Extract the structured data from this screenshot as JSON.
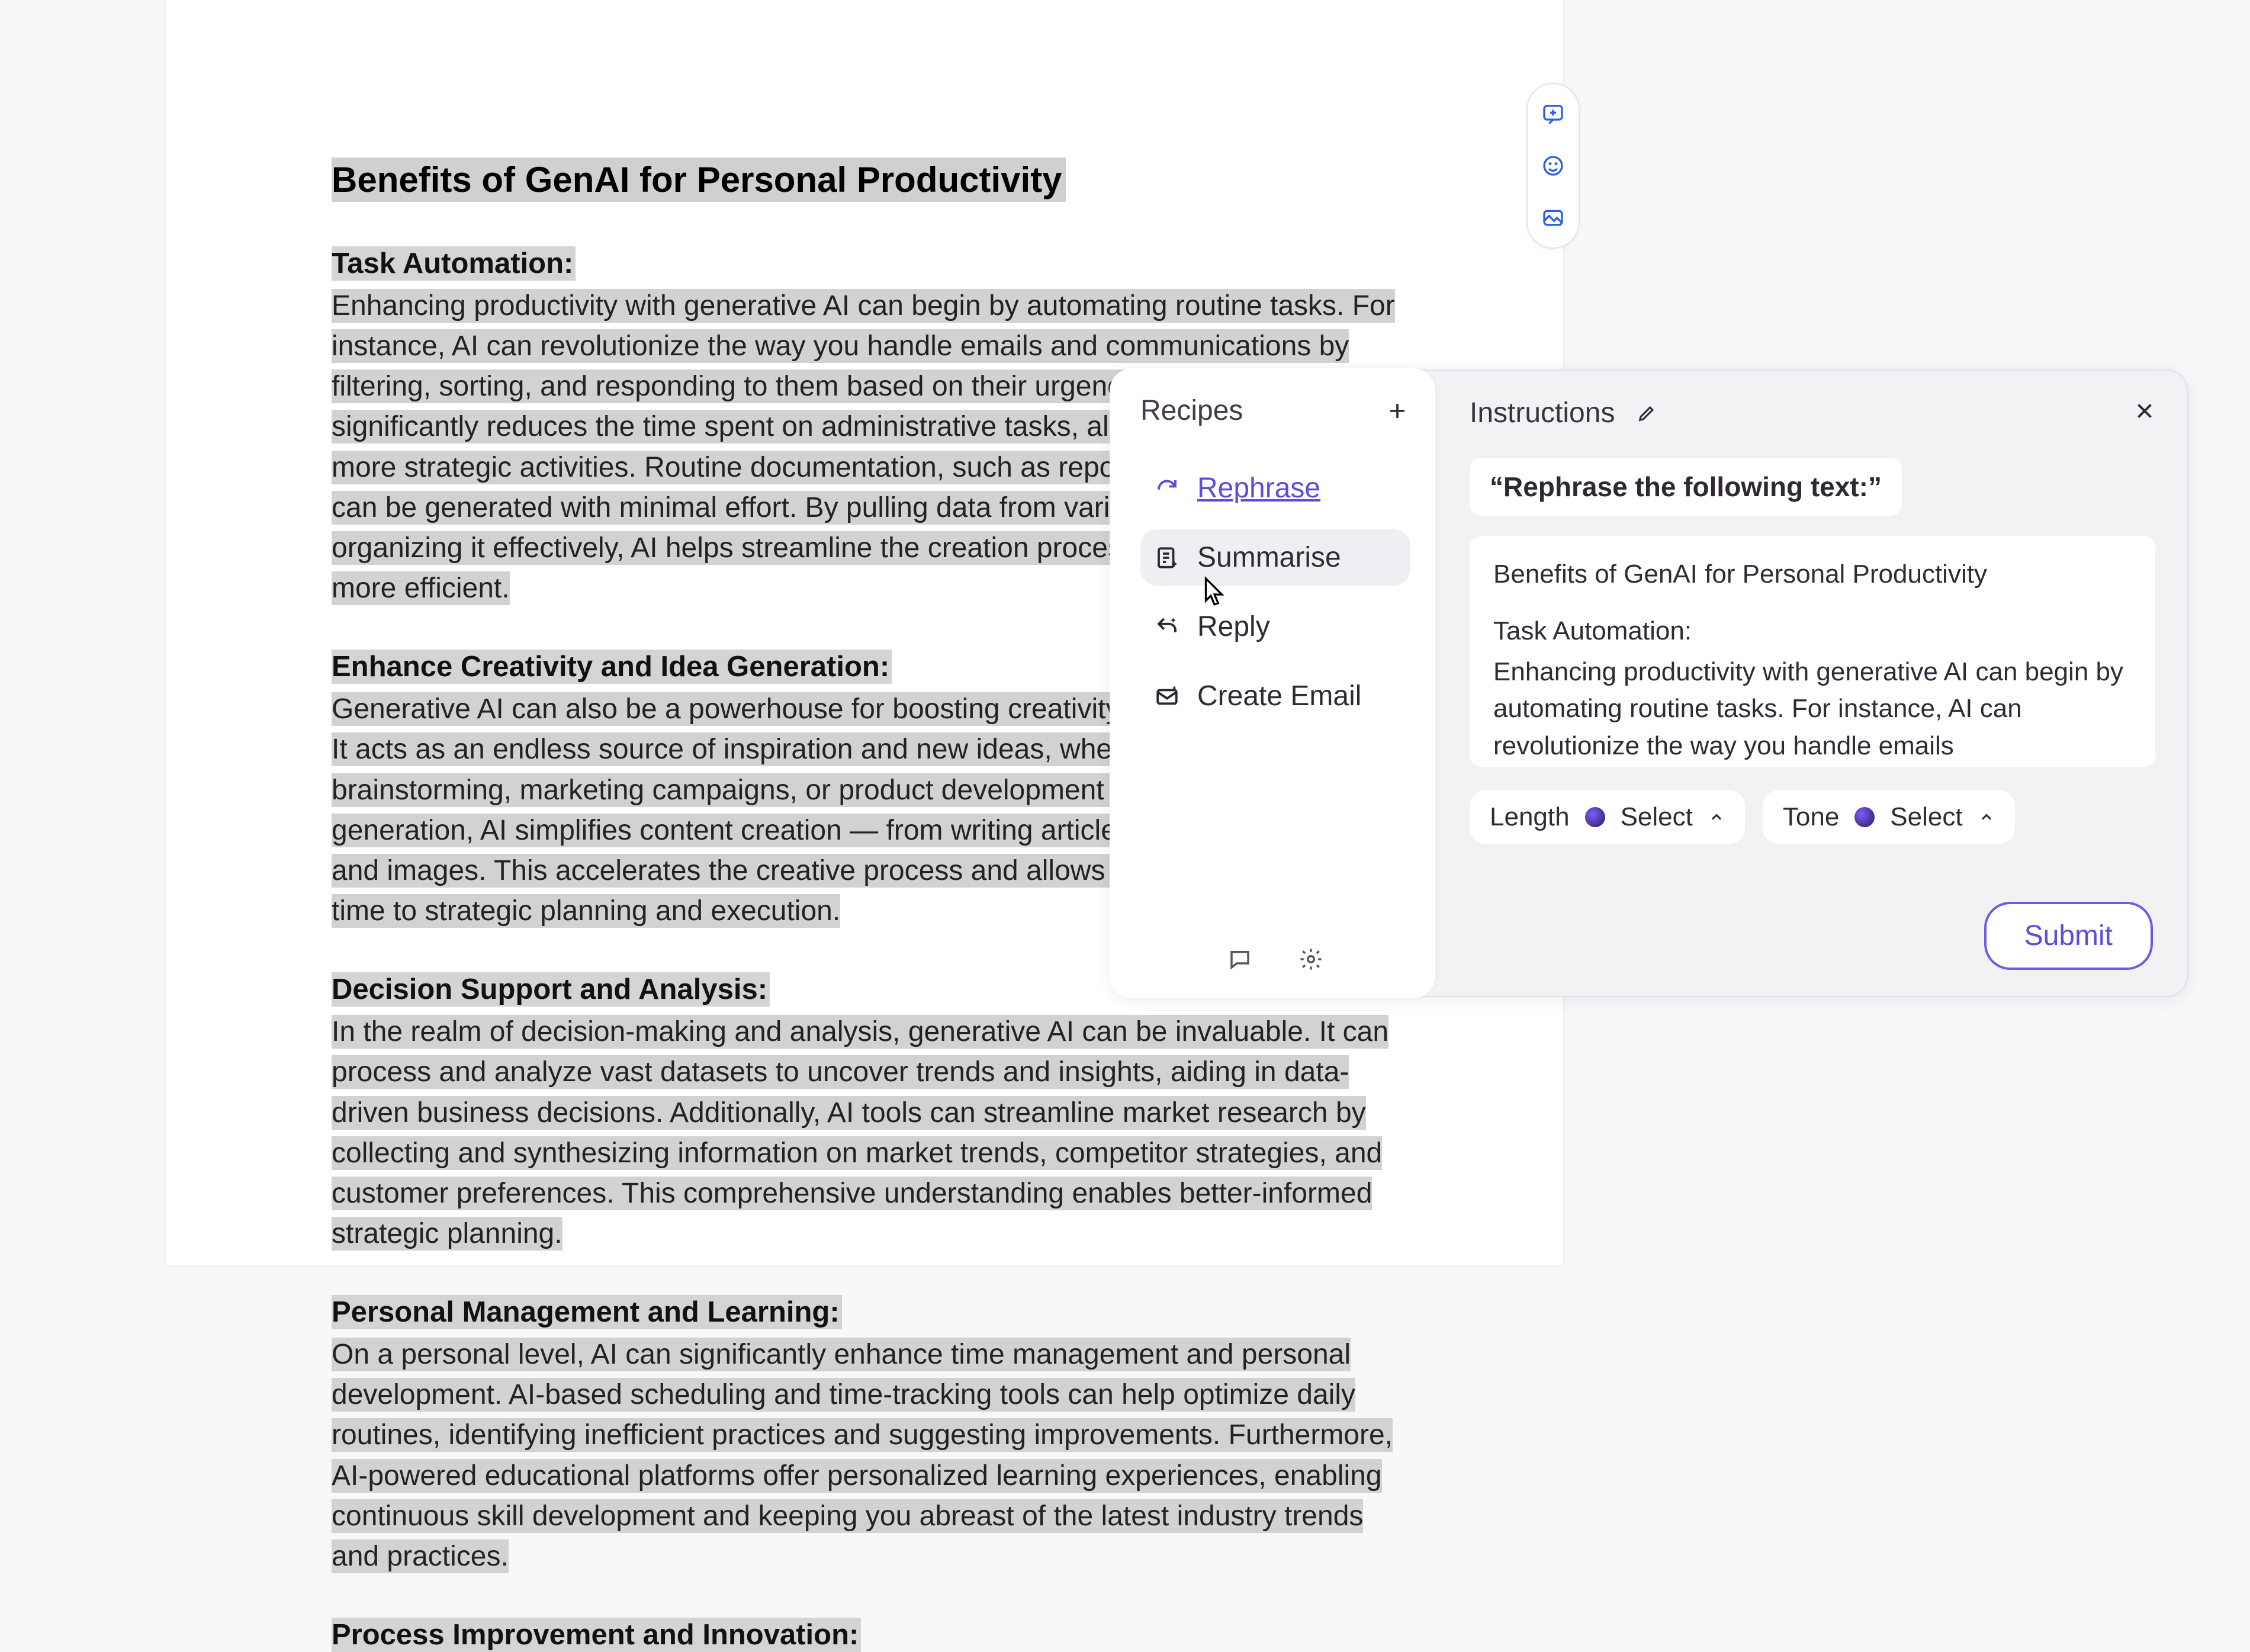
{
  "document": {
    "title": "Benefits of GenAI for Personal Productivity",
    "sections": [
      {
        "heading": "Task Automation:",
        "body": "Enhancing productivity with generative AI can begin by automating routine tasks. For instance, AI can revolutionize the way you handle emails and communications by filtering, sorting, and responding to them based on their urgency and relevance. This significantly reduces the time spent on administrative tasks, allowing you to focus on more strategic activities. Routine documentation, such as reports and presentations, can be generated with minimal effort. By pulling data from various sources and organizing it effectively, AI helps streamline the creation process, making it faster and more efficient."
      },
      {
        "heading": "Enhance Creativity and Idea Generation:",
        "body": "Generative AI can also be a powerhouse for boosting creativity and idea generation. It acts as an endless source of inspiration and new ideas, whether for project brainstorming, marketing campaigns, or product development initiatives. Beyond idea generation, AI simplifies content creation — from writing articles to producing videos and images. This accelerates the creative process and allows you to allocate more time to strategic planning and execution."
      },
      {
        "heading": "Decision Support and Analysis:",
        "body": "In the realm of decision-making and analysis, generative AI can be invaluable. It can process and analyze vast datasets to uncover trends and insights, aiding in data-driven business decisions. Additionally, AI tools can streamline market research by collecting and synthesizing information on market trends, competitor strategies, and customer preferences. This comprehensive understanding enables better-informed strategic planning."
      },
      {
        "heading": "Personal Management and Learning:",
        "body": "On a personal level, AI can significantly enhance time management and personal development. AI-based scheduling and time-tracking tools can help optimize daily routines, identifying inefficient practices and suggesting improvements. Furthermore, AI-powered educational platforms offer personalized learning experiences, enabling continuous skill development and keeping you abreast of the latest industry trends and practices."
      },
      {
        "heading": "Process Improvement and Innovation:",
        "body": ""
      }
    ]
  },
  "recipes": {
    "title": "Recipes",
    "items": [
      {
        "label": "Rephrase",
        "icon": "refresh",
        "active": true,
        "hovered": false
      },
      {
        "label": "Summarise",
        "icon": "doc-sparkle",
        "active": false,
        "hovered": true
      },
      {
        "label": "Reply",
        "icon": "reply-sparkle",
        "active": false,
        "hovered": false
      },
      {
        "label": "Create Email",
        "icon": "mail-sparkle",
        "active": false,
        "hovered": false
      }
    ]
  },
  "instructions": {
    "title": "Instructions",
    "prompt": "“Rephrase the following text:”",
    "context_title": "Benefits of GenAI for Personal Productivity",
    "context_heading": "Task Automation:",
    "context_body": "Enhancing productivity with generative AI can begin by automating routine tasks. For instance, AI can revolutionize the way you handle emails",
    "length_label": "Length",
    "length_value": "Select",
    "tone_label": "Tone",
    "tone_value": "Select",
    "submit": "Submit"
  }
}
